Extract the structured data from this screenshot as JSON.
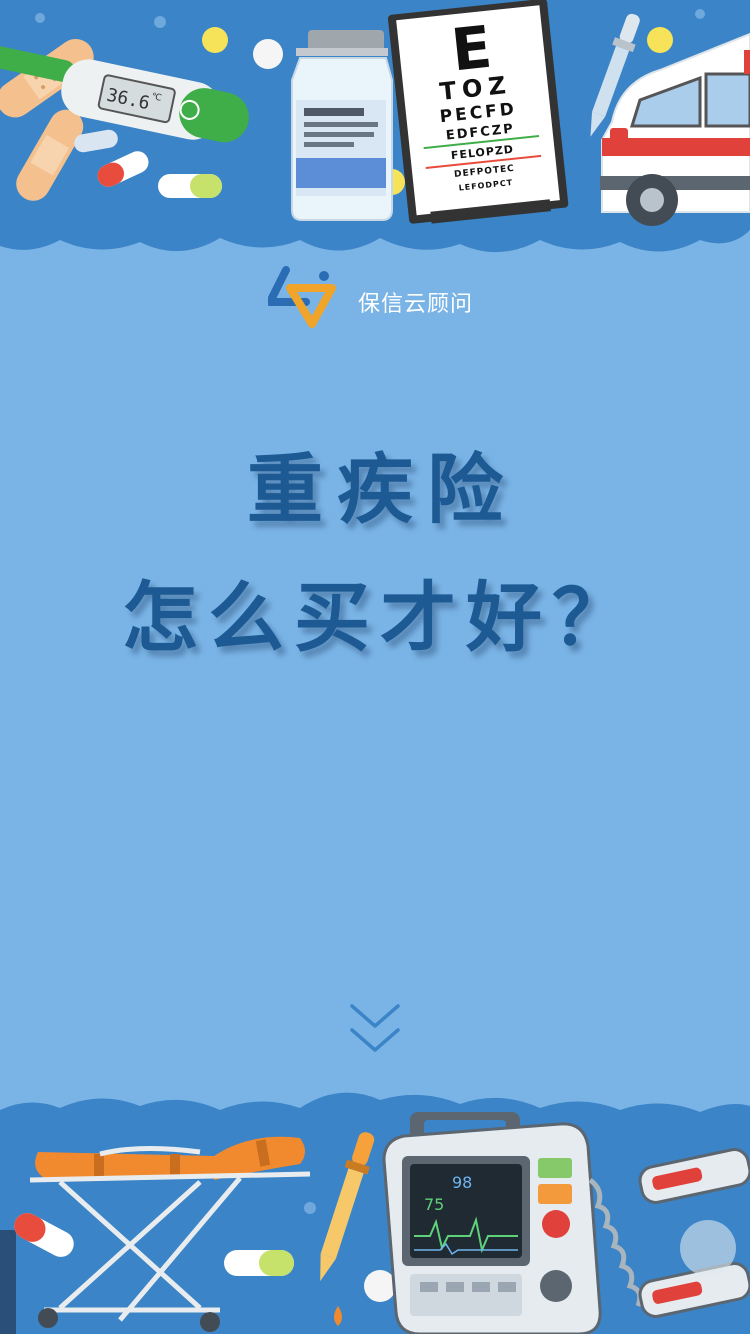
{
  "brand": {
    "name": "保信云顾问"
  },
  "headline": {
    "line1": "重疾险",
    "line2": "怎么买才好？"
  },
  "decor": {
    "thermometer_reading": "36.6℃",
    "eye_chart": {
      "rows": [
        "E",
        "TOZ",
        "PECFD",
        "EDFCZP",
        "FELOPZD",
        "DEFPOTEC",
        "LEFODPCT"
      ]
    },
    "monitor": {
      "heart_rate": "75",
      "spo2": "98"
    }
  },
  "colors": {
    "background": "#7ab4e6",
    "band": "#3a84c7",
    "headline": "#1d5a93",
    "brand_text": "#ffffff",
    "logo_blue": "#2a6db5",
    "logo_orange": "#f0a52a"
  },
  "icons": {
    "scroll_hint": "chevron-double-down-icon",
    "brand_logo": "triangle-logo-icon"
  }
}
